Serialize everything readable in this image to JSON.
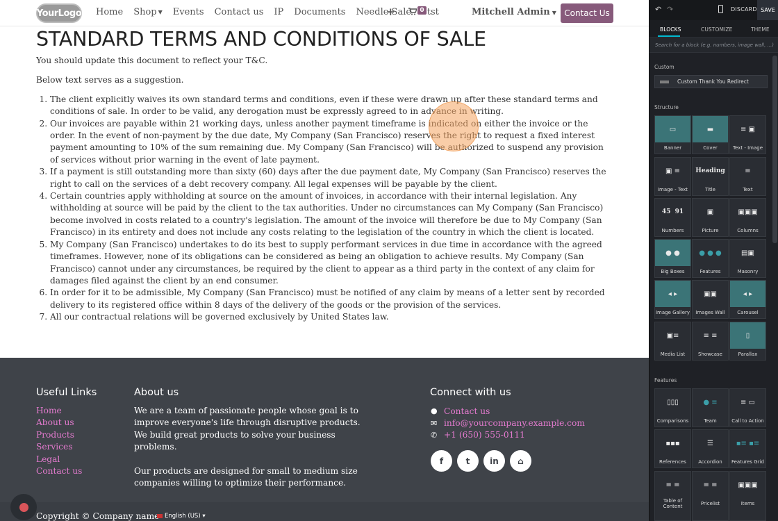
{
  "navbar": {
    "logo": "YourLogo",
    "menu": [
      {
        "label": "Home",
        "dropdown": false
      },
      {
        "label": "Shop",
        "dropdown": true
      },
      {
        "label": "Events",
        "dropdown": false
      },
      {
        "label": "Contact us",
        "dropdown": false
      },
      {
        "label": "IP",
        "dropdown": false
      },
      {
        "label": "Documents",
        "dropdown": false
      },
      {
        "label": "Needle Sale",
        "dropdown": false
      },
      {
        "label": "etst",
        "dropdown": false
      }
    ],
    "plus_icon": "+",
    "cart_count": "0",
    "user_name": "Mitchell Admin",
    "contact_button": "Contact Us"
  },
  "page": {
    "title": "STANDARD TERMS AND CONDITIONS OF SALE",
    "intro": "You should update this document to reflect your T&C.",
    "suggestion": "Below text serves as a suggestion.",
    "terms": [
      "The client explicitly waives its own standard terms and conditions, even if these were drawn up after these standard terms and conditions of sale. In order to be valid, any derogation must be expressly agreed to in advance in writing.",
      "Our invoices are payable within 21 working days, unless another payment timeframe is indicated on either the invoice or the order. In the event of non-payment by the due date, My Company (San Francisco) reserves the right to request a fixed interest payment amounting to 10% of the sum remaining due. My Company (San Francisco) will be authorized to suspend any provision of services without prior warning in the event of late payment.",
      "If a payment is still outstanding more than sixty (60) days after the due payment date, My Company (San Francisco) reserves the right to call on the services of a debt recovery company. All legal expenses will be payable by the client.",
      "Certain countries apply withholding at source on the amount of invoices, in accordance with their internal legislation. Any withholding at source will be paid by the client to the tax authorities. Under no circumstances can My Company (San Francisco) become involved in costs related to a country's legislation. The amount of the invoice will therefore be due to My Company (San Francisco) in its entirety and does not include any costs relating to the legislation of the country in which the client is located.",
      "My Company (San Francisco) undertakes to do its best to supply performant services in due time in accordance with the agreed timeframes. However, none of its obligations can be considered as being an obligation to achieve results. My Company (San Francisco) cannot under any circumstances, be required by the client to appear as a third party in the context of any claim for damages filed against the client by an end consumer.",
      "In order for it to be admissible, My Company (San Francisco) must be notified of any claim by means of a letter sent by recorded delivery to its registered office within 8 days of the delivery of the goods or the provision of the services.",
      "All our contractual relations will be governed exclusively by United States law."
    ]
  },
  "footer": {
    "useful_links_title": "Useful Links",
    "useful_links": [
      "Home",
      "About us",
      "Products",
      "Services",
      "Legal",
      "Contact us"
    ],
    "about_title": "About us",
    "about_p1": "We are a team of passionate people whose goal is to improve everyone's life through disruptive products. We build great products to solve your business problems.",
    "about_p2": "Our products are designed for small to medium size companies willing to optimize their performance.",
    "connect_title": "Connect with us",
    "connect_items": [
      {
        "icon": "comment-icon",
        "text": "Contact us"
      },
      {
        "icon": "envelope-icon",
        "text": "info@yourcompany.example.com"
      },
      {
        "icon": "phone-icon",
        "text": "+1 (650) 555-0111"
      }
    ],
    "social": [
      {
        "icon": "facebook-icon",
        "glyph": "f"
      },
      {
        "icon": "twitter-icon",
        "glyph": "t"
      },
      {
        "icon": "linkedin-icon",
        "glyph": "in"
      },
      {
        "icon": "home-icon",
        "glyph": "⌂"
      }
    ],
    "copyright": "Copyright © Company name",
    "language": "English (US)"
  },
  "editor": {
    "discard": "DISCARD",
    "save": "SAVE",
    "tabs": [
      "BLOCKS",
      "CUSTOMIZE",
      "THEME"
    ],
    "search_placeholder": "Search for a block (e.g. numbers, image wall, ...)",
    "custom_section": "Custom",
    "custom_item": "Custom Thank You Redirect",
    "structure_section": "Structure",
    "structure_blocks": [
      "Banner",
      "Cover",
      "Text - Image",
      "Image - Text",
      "Title",
      "Text",
      "Numbers",
      "Picture",
      "Columns",
      "Big Boxes",
      "Features",
      "Masonry",
      "Image Gallery",
      "Images Wall",
      "Carousel",
      "Media List",
      "Showcase",
      "Parallax"
    ],
    "features_section": "Features",
    "feature_blocks": [
      "Comparisons",
      "Team",
      "Call to Action",
      "References",
      "Accordion",
      "Features Grid",
      "Table of Content",
      "Pricelist",
      "Items"
    ],
    "title_thumb_text": "Heading",
    "numbers_thumb_text": "45  91"
  },
  "colors": {
    "brand": "#875a7b",
    "footer_link": "#e47bcf",
    "footer_bg": "#3f4349",
    "panel_bg": "#1f2126",
    "accent_tab": "#01bad2"
  }
}
